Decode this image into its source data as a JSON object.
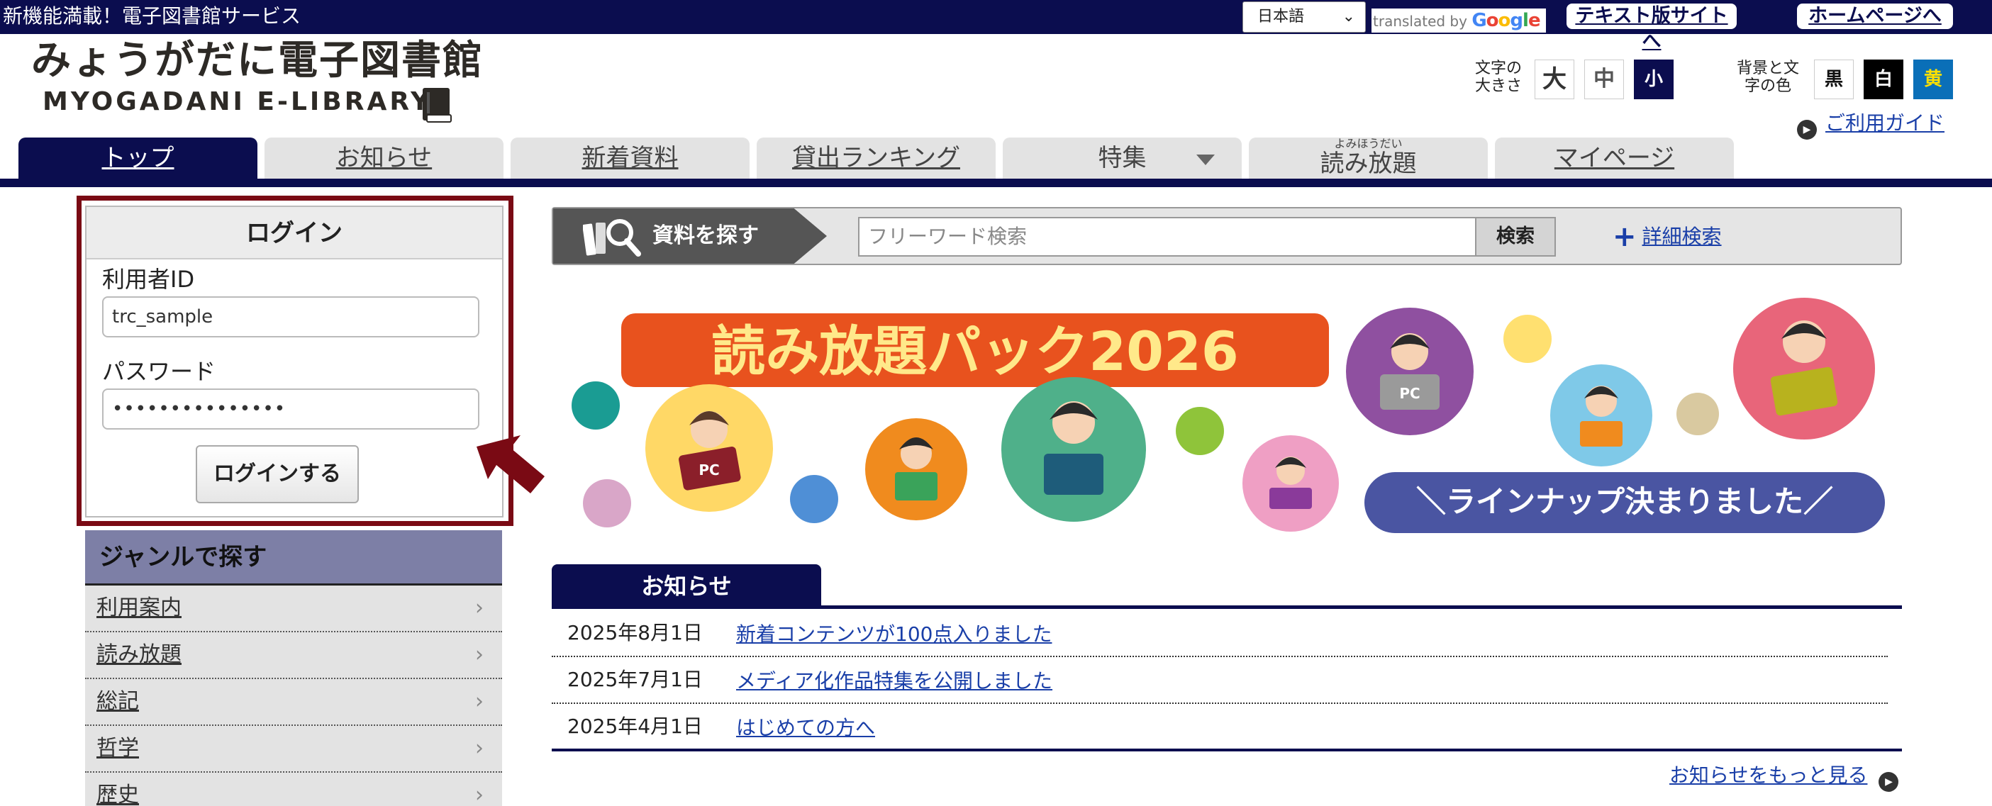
{
  "topbar": {
    "tagline": "新機能満載！電子図書館サービス",
    "language": "日本語",
    "translated_by": "translated by",
    "google": "Google",
    "text_site": "テキスト版サイトへ",
    "homepage": "ホームページへ"
  },
  "header": {
    "logo_jp": "みょうがだに電子図書館",
    "logo_en": "MYOGADANI E-LIBRARY",
    "font_size_label": "文字の大きさ",
    "font_sizes": [
      "大",
      "中",
      "小"
    ],
    "bg_color_label": "背景と文字の色",
    "bg_colors": [
      "黒",
      "白",
      "黄"
    ],
    "guide": "ご利用ガイド"
  },
  "nav": {
    "tabs": [
      {
        "label": "トップ"
      },
      {
        "label": "お知らせ"
      },
      {
        "label": "新着資料"
      },
      {
        "label": "貸出ランキング"
      },
      {
        "label": "特集"
      },
      {
        "label": "読み放題",
        "ruby": "よみほうだい"
      },
      {
        "label": "マイページ"
      }
    ]
  },
  "login": {
    "title": "ログイン",
    "user_id_label": "利用者ID",
    "user_id_value": "trc_sample",
    "password_label": "パスワード",
    "password_value": "•••••••••••••••",
    "submit": "ログインする"
  },
  "genre": {
    "title": "ジャンルで探す",
    "items": [
      "利用案内",
      "読み放題",
      "総記",
      "哲学",
      "歴史"
    ]
  },
  "search": {
    "label": "資料を探す",
    "placeholder": "フリーワード検索",
    "button": "検索",
    "advanced": "詳細検索"
  },
  "banner": {
    "title": "読み放題パック2026",
    "subtitle": "＼ラインナップ決まりました／",
    "laptop_label": "PC"
  },
  "news": {
    "title": "お知らせ",
    "items": [
      {
        "date": "2025年8月1日",
        "title": "新着コンテンツが100点入りました"
      },
      {
        "date": "2025年7月1日",
        "title": "メディア化作品特集を公開しました"
      },
      {
        "date": "2025年4月1日",
        "title": "はじめての方へ"
      }
    ],
    "more": "お知らせをもっと見る"
  },
  "colors": {
    "navy": "#0b0d4f",
    "login_frame": "#7a0a14",
    "banner_orange": "#e8521e",
    "banner_yellow": "#ffe98a",
    "banner_purple": "#4a55a2"
  }
}
